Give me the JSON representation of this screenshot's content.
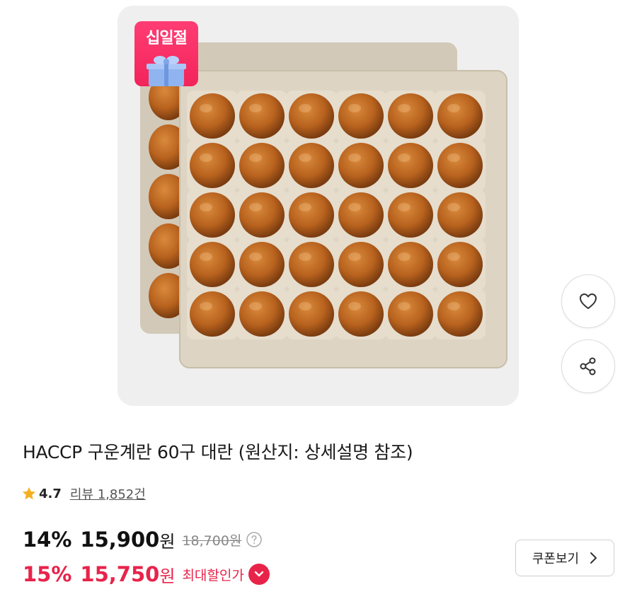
{
  "product": {
    "badge_label": "십일절",
    "title": "HACCP 구운계란 60구 대란 (원산지: 상세설명 참조)",
    "rating": "4.7",
    "review_text": "리뷰 1,852건"
  },
  "price": {
    "discount_rate": "14%",
    "sale_price": "15,900",
    "currency": "원",
    "original_price": "18,700원",
    "max_discount_rate": "15%",
    "max_discount_price": "15,750",
    "max_discount_label": "최대할인가"
  },
  "actions": {
    "coupon_label": "쿠폰보기"
  },
  "icons": {
    "wishlist": "heart-icon",
    "share": "share-icon",
    "rating": "star-icon",
    "price_help": "help-circle-icon",
    "expand": "chevron-down-icon",
    "coupon": "chevron-right-icon"
  },
  "colors": {
    "accent": "#e8234a",
    "badge": "#f2245a",
    "star": "#f5b021",
    "egg": "#b8621e",
    "tray": "#ddd4c4"
  }
}
